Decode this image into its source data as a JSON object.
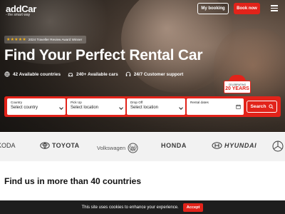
{
  "header": {
    "logo": "addCar",
    "tagline": "- the smart way",
    "my_booking": "My booking",
    "book_now": "Book now"
  },
  "hero": {
    "award_stars": "★★★★★",
    "award_text": "2024 Traveller Review Award Winner",
    "title": "Find Your Perfect Rental Car",
    "features": [
      {
        "icon": "globe-icon",
        "label": "42 Available countries"
      },
      {
        "icon": "car-icon",
        "label": "240+ Available cars"
      },
      {
        "icon": "headset-icon",
        "label": "24/7 Customer support"
      }
    ],
    "badge": {
      "small": "CELEBRATING",
      "big": "20 YEARS"
    }
  },
  "search": {
    "country": {
      "label": "Country",
      "value": "Select country"
    },
    "pickup": {
      "label": "Pick Up",
      "value": "Select location"
    },
    "dropoff": {
      "label": "Drop Off",
      "value": "Select location"
    },
    "dates": {
      "label": "Rental dates",
      "value": ""
    },
    "button": "Search"
  },
  "brands": [
    "KODA",
    "TOYOTA",
    "Volkswagen",
    "HONDA",
    "HYUNDAI"
  ],
  "section": {
    "title": "Find us in more than 40 countries"
  },
  "cookie": {
    "text": "This site uses cookies to enhance your experience.",
    "accept": "Accept"
  },
  "colors": {
    "accent": "#e2231a",
    "cookie_bg": "#1e1e1e",
    "brand_strip": "#f2f2f2"
  }
}
